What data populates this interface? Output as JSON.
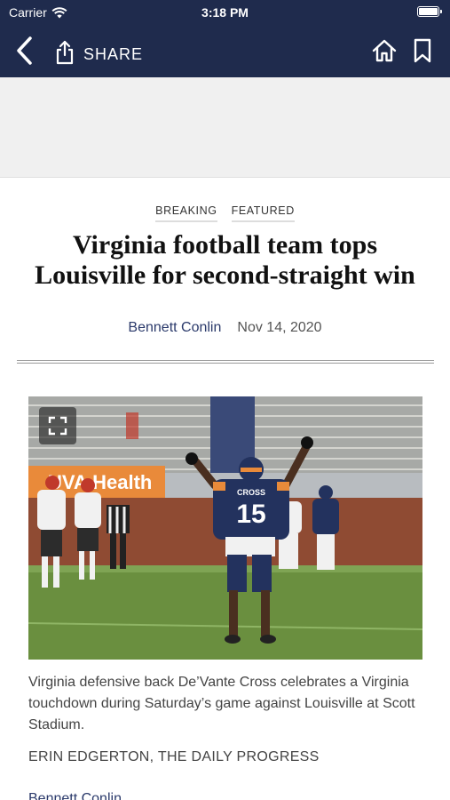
{
  "status_bar": {
    "carrier": "Carrier",
    "time": "3:18 PM"
  },
  "nav": {
    "share_label": "SHARE"
  },
  "article": {
    "tags": [
      "BREAKING",
      "FEATURED"
    ],
    "headline": "Virginia football team tops Louisville for second-straight win",
    "author": "Bennett Conlin",
    "date": "Nov 14, 2020",
    "photo": {
      "banner_text": "UVA Health",
      "jersey_name": "CROSS",
      "jersey_number": "15",
      "caption": "Virginia defensive back De’Vante Cross celebrates a Virginia touchdown during Saturday’s game against Louisville at Scott Stadium.",
      "credit": "ERIN EDGERTON, THE DAILY PROGRESS"
    },
    "body_author_link": "Bennett Conlin"
  },
  "colors": {
    "nav_bg": "#1f2b4d",
    "link": "#2b3a6b",
    "ad_bg": "#f0f0f0"
  }
}
